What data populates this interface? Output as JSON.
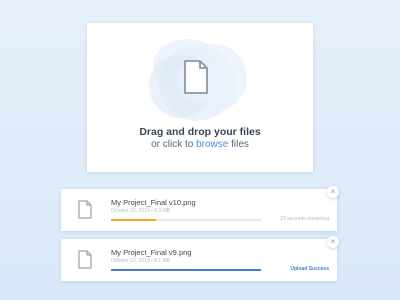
{
  "dropzone": {
    "title": "Drag and drop your files",
    "sub_prefix": "or click to",
    "sub_link": "browse",
    "sub_suffix": "files",
    "icon": "file-icon"
  },
  "uploads": [
    {
      "name": "My Project_Final v10.png",
      "meta": "October 22, 2019 • 8.3 MB",
      "progress": 0.3,
      "status": "23 seconds remaining",
      "close": "×"
    },
    {
      "name": "My Project_Final v9.png",
      "meta": "October 22, 2019 • 8.1 MB",
      "progress": 1.0,
      "status": "Upload Success",
      "close": "×"
    }
  ],
  "colors": {
    "accent": "#3f7fd6",
    "progress_active": "#f5a623",
    "link": "#4b8ee0"
  }
}
